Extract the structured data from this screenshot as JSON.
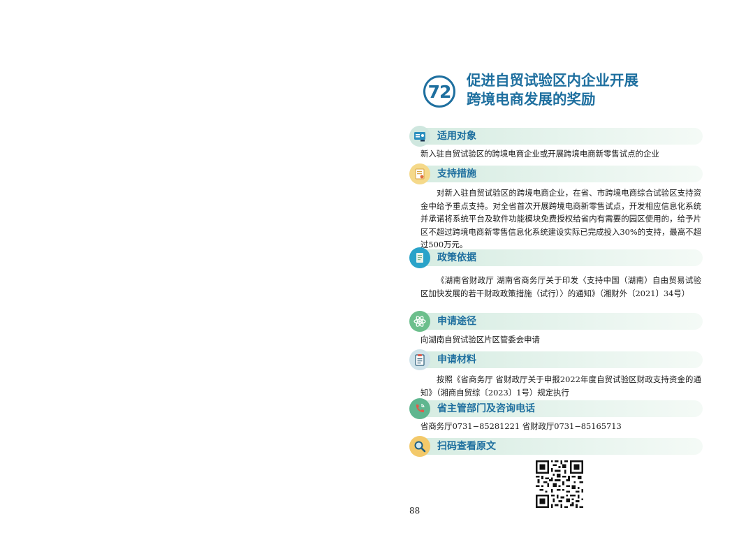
{
  "page": {
    "number": "88"
  },
  "title": {
    "number": "72",
    "line1": "促进自贸试验区内企业开展",
    "line2": "跨境电商发展的奖励"
  },
  "sections": [
    {
      "label": "适用对象",
      "icon": "id-card-icon",
      "text": "新入驻自贸试验区的跨境电商企业或开展跨境电商新零售试点的企业"
    },
    {
      "label": "支持措施",
      "icon": "certificate-icon",
      "text": "对新入驻自贸试验区的跨境电商企业，在省、市跨境电商综合试验区支持资金中给予重点支持。对全省首次开展跨境电商新零售试点，开发相应信息化系统并承诺将系统平台及软件功能模块免费授权给省内有需要的园区使用的，给予片区不超过跨境电商新零售信息化系统建设实际已完成投入30%的支持，最高不超过500万元。"
    },
    {
      "label": "政策依据",
      "icon": "document-icon",
      "text": "《湖南省财政厅 湖南省商务厅关于印发〈支持中国（湖南）自由贸易试验区加快发展的若干财政政策措施（试行）〉的通知》（湘财外〔2021〕34号）"
    },
    {
      "label": "申请途径",
      "icon": "atom-icon",
      "text": "向湖南自贸试验区片区管委会申请"
    },
    {
      "label": "申请材料",
      "icon": "clipboard-icon",
      "text": "按照《省商务厅 省财政厅关于申报2022年度自贸试验区财政支持资金的通知》（湘商自贸综〔2023〕1号）规定执行"
    },
    {
      "label": "省主管部门及咨询电话",
      "icon": "phone-icon",
      "text": "省商务厅0731−85281221  省财政厅0731−85165713"
    },
    {
      "label": "扫码查看原文",
      "icon": "magnifier-icon",
      "text": ""
    }
  ],
  "colors": {
    "accent": "#1e6f9f",
    "bar": "#d6ece2"
  }
}
